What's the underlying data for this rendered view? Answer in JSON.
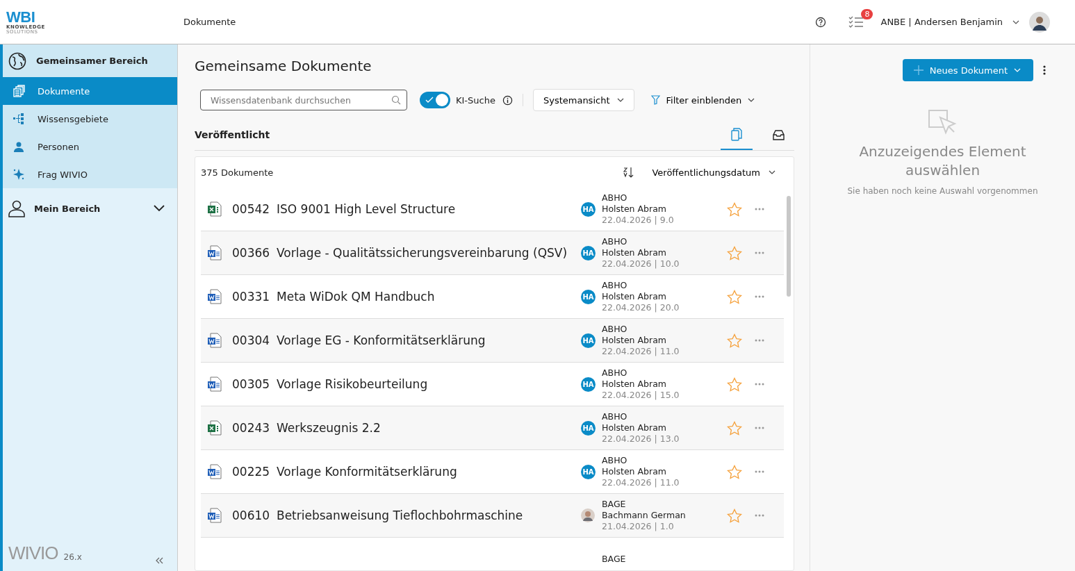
{
  "header": {
    "logo": "WBI",
    "logo_tagline_1": "KNOWLEDGE",
    "logo_tagline_2": "SOLUTIONS",
    "breadcrumb": "Dokumente",
    "task_count": "8",
    "user": "ANBE | Andersen Benjamin"
  },
  "sidebar": {
    "section": "Gemeinsamer Bereich",
    "items": [
      {
        "label": "Dokumente",
        "kind": "documents",
        "selected": true
      },
      {
        "label": "Wissensgebiete",
        "kind": "tree",
        "selected": false
      },
      {
        "label": "Personen",
        "kind": "person",
        "selected": false
      },
      {
        "label": "Frag WIVIO",
        "kind": "sparkle",
        "selected": false
      }
    ],
    "my_area": {
      "label": "Mein Bereich",
      "expanded": false
    },
    "footer_logo": "WIVIO",
    "version": "26.x"
  },
  "page": {
    "title": "Gemeinsame Dokumente",
    "new_button": "Neues Dokument",
    "search": {
      "placeholder": "Wissensdatenbank durchsuchen"
    },
    "ai_search": {
      "label": "KI-Suche",
      "on": true
    },
    "view": "Systemansicht",
    "filter": "Filter einblenden",
    "section": "Veröffentlicht",
    "view_tabs": [
      {
        "kind": "clipboard",
        "selected": true
      },
      {
        "kind": "inbox",
        "selected": false
      }
    ],
    "count": "375 Dokumente",
    "sort": "Veröffentlichungsdatum",
    "rows": [
      {
        "kind": "excel",
        "number": "00542",
        "title": "ISO 9001 High Level Structure",
        "owner_code": "ABHO",
        "owner": "Holsten Abram",
        "initials": "HA",
        "meta": "22.04.2026 | 9.0",
        "favorite": false
      },
      {
        "kind": "word",
        "number": "00366",
        "title": "Vorlage - Qualitätssicherungsvereinbarung (QSV)",
        "owner_code": "ABHO",
        "owner": "Holsten Abram",
        "initials": "HA",
        "meta": "22.04.2026 | 10.0",
        "favorite": false
      },
      {
        "kind": "word",
        "number": "00331",
        "title": "Meta WiDok QM Handbuch",
        "owner_code": "ABHO",
        "owner": "Holsten Abram",
        "initials": "HA",
        "meta": "22.04.2026 | 20.0",
        "favorite": false
      },
      {
        "kind": "word",
        "number": "00304",
        "title": "Vorlage EG - Konformitätserklärung",
        "owner_code": "ABHO",
        "owner": "Holsten Abram",
        "initials": "HA",
        "meta": "22.04.2026 | 11.0",
        "favorite": false
      },
      {
        "kind": "word",
        "number": "00305",
        "title": "Vorlage Risikobeurteilung",
        "owner_code": "ABHO",
        "owner": "Holsten Abram",
        "initials": "HA",
        "meta": "22.04.2026 | 15.0",
        "favorite": false
      },
      {
        "kind": "excel",
        "number": "00243",
        "title": "Werkszeugnis 2.2",
        "owner_code": "ABHO",
        "owner": "Holsten Abram",
        "initials": "HA",
        "meta": "22.04.2026 | 13.0",
        "favorite": false
      },
      {
        "kind": "word",
        "number": "00225",
        "title": "Vorlage Konformitätserklärung",
        "owner_code": "ABHO",
        "owner": "Holsten Abram",
        "initials": "HA",
        "meta": "22.04.2026 | 11.0",
        "favorite": false
      },
      {
        "kind": "word",
        "number": "00610",
        "title": "Betriebsanweisung Tieflochbohrmaschine",
        "owner_code": "BAGE",
        "owner": "Bachmann German",
        "meta": "21.04.2026 | 1.0",
        "favorite": false
      },
      {
        "owner_code": "BAGE"
      }
    ]
  },
  "detail": {
    "title": "Anzuzeigendes Element auswählen",
    "subtitle": "Sie haben noch keine Auswahl vorgenommen"
  }
}
